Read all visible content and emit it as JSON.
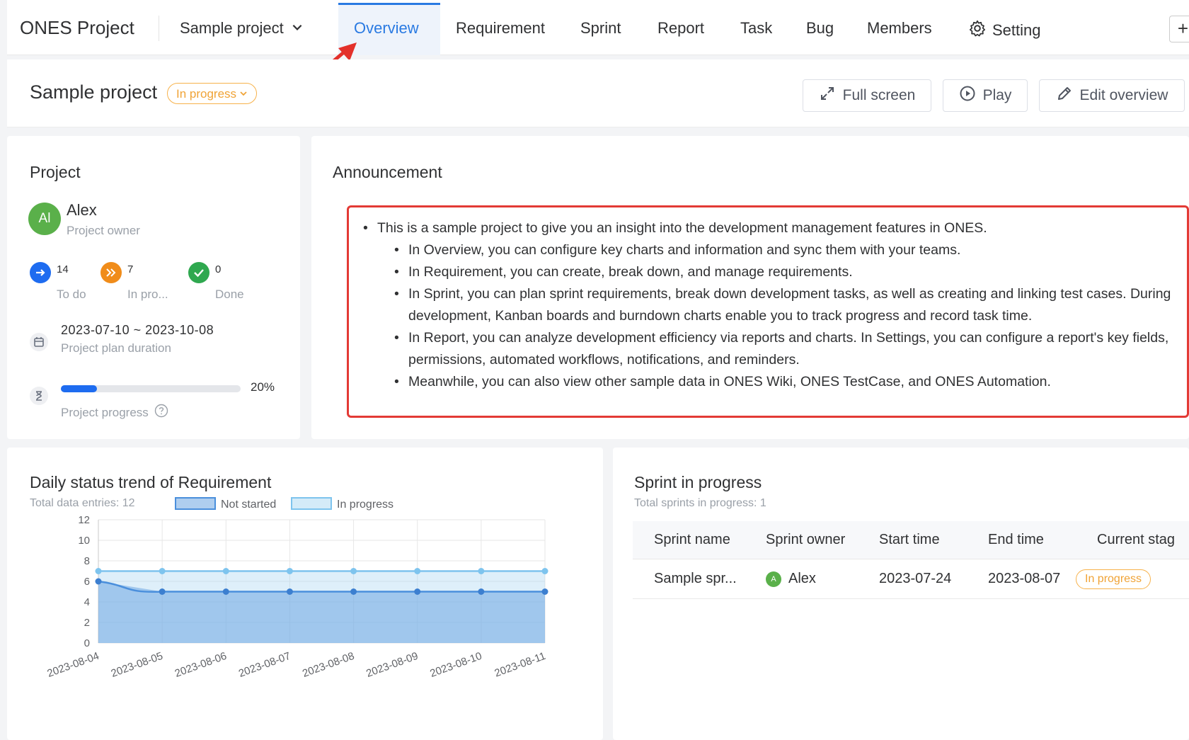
{
  "nav": {
    "brand": "ONES Project",
    "project_select": "Sample project",
    "tabs": [
      {
        "label": "Overview"
      },
      {
        "label": "Requirement"
      },
      {
        "label": "Sprint"
      },
      {
        "label": "Report"
      },
      {
        "label": "Task"
      },
      {
        "label": "Bug"
      },
      {
        "label": "Members"
      },
      {
        "label": "Setting"
      }
    ],
    "plus": "+"
  },
  "header": {
    "title": "Sample project",
    "status": "In progress",
    "buttons": {
      "fullscreen": "Full screen",
      "play": "Play",
      "edit": "Edit overview"
    }
  },
  "project_card": {
    "title": "Project",
    "avatar": "Al",
    "owner_name": "Alex",
    "owner_role": "Project owner",
    "stats": [
      {
        "count": "14",
        "label": "To do"
      },
      {
        "count": "7",
        "label": "In pro..."
      },
      {
        "count": "0",
        "label": "Done"
      }
    ],
    "dates": "2023-07-10 ~ 2023-10-08",
    "dates_label": "Project plan duration",
    "progress_value": 0.2,
    "progress_text": "20%",
    "progress_label": "Project progress",
    "colors": {
      "todo": "#1e6cf0",
      "in_progress": "#f08c1a",
      "done": "#2fa84f"
    }
  },
  "announcement": {
    "title": "Announcement",
    "items": [
      {
        "text": "This is a sample project to give you an insight into the development management features in ONES."
      },
      {
        "text": "In Overview, you can configure key charts and information and sync them with your teams."
      },
      {
        "text": "In Requirement, you can create, break down, and manage requirements."
      },
      {
        "text": "In Sprint, you can plan sprint requirements, break down development tasks, as well as creating and linking test cases. During development, Kanban boards and burndown charts enable you to track progress and record task time."
      },
      {
        "text": "In Report, you can analyze development efficiency via reports and charts. In Settings, you can configure a report's key fields, permissions, automated workflows, notifications, and reminders."
      },
      {
        "text": "Meanwhile, you can also view other sample data in ONES Wiki, ONES TestCase, and ONES Automation."
      }
    ]
  },
  "trend_card": {
    "title": "Daily status trend of Requirement",
    "subtitle": "Total data entries: 12"
  },
  "chart_data": {
    "type": "area",
    "x": [
      "2023-08-04",
      "2023-08-05",
      "2023-08-06",
      "2023-08-07",
      "2023-08-08",
      "2023-08-09",
      "2023-08-10",
      "2023-08-11"
    ],
    "series": [
      {
        "name": "Not started",
        "values": [
          6,
          5,
          5,
          5,
          5,
          5,
          5,
          5
        ],
        "color": "#4a8fdc"
      },
      {
        "name": "In progress",
        "values": [
          7,
          7,
          7,
          7,
          7,
          7,
          7,
          7
        ],
        "color": "#7ec4ee"
      }
    ],
    "ylim": [
      0,
      12
    ],
    "yticks": [
      0,
      2,
      4,
      6,
      8,
      10,
      12
    ],
    "grid": true,
    "legend": "top-center"
  },
  "sprint_card": {
    "title": "Sprint in progress",
    "subtitle": "Total sprints in progress: 1",
    "columns": [
      "Sprint name",
      "Sprint owner",
      "Start time",
      "End time",
      "Current stag"
    ],
    "rows": [
      {
        "name": "Sample spr...",
        "avatar": "A",
        "owner": "Alex",
        "start": "2023-07-24",
        "end": "2023-08-07",
        "stage": "In progress"
      }
    ]
  }
}
